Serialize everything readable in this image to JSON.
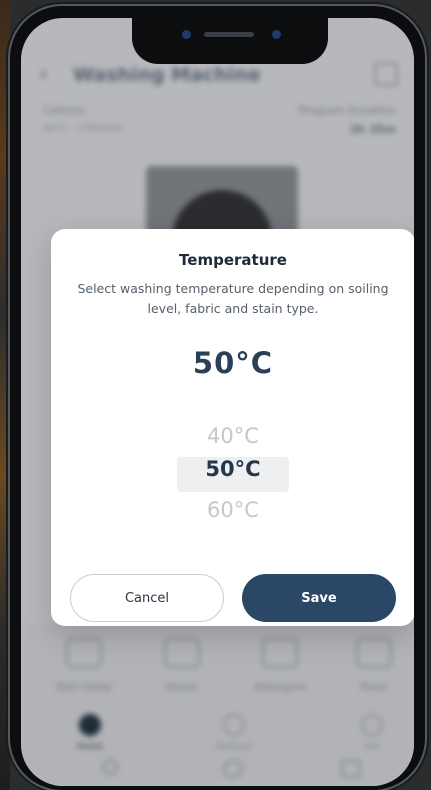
{
  "background_app": {
    "title": "Washing Machine",
    "info_left": {
      "label": "Cottons",
      "sub": "40°C · 1400rpm"
    },
    "info_right": {
      "label": "Program Duration",
      "value": "2h 35m"
    },
    "features": [
      "Start Delay",
      "Steam",
      "Detergent",
      "Rinse"
    ],
    "tabs": [
      "Home",
      "Settings",
      "Info"
    ]
  },
  "dialog": {
    "title": "Temperature",
    "description": "Select washing temperature depending on soiling level, fabric and stain type.",
    "current_value": "50°C",
    "options": [
      "40°C",
      "50°C",
      "60°C"
    ],
    "selected_index": 1,
    "cancel_label": "Cancel",
    "save_label": "Save"
  },
  "colors": {
    "accent": "#2a4766",
    "title": "#1e2a38",
    "value": "#2b3f57"
  }
}
